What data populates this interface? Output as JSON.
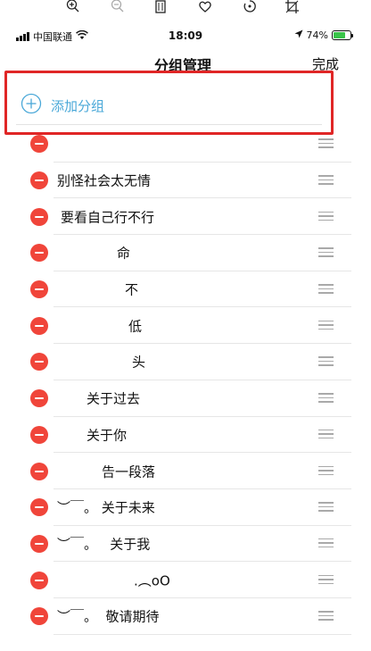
{
  "viewer_toolbar": {
    "icons": [
      "zoom-in-icon",
      "zoom-out-icon",
      "trash-icon",
      "heart-icon",
      "rotate-icon",
      "crop-icon"
    ]
  },
  "status_bar": {
    "carrier": "中国联通",
    "time": "18:09",
    "battery": "74%",
    "battery_level": 0.74,
    "icons": [
      "signal-icon",
      "wifi-icon",
      "location-icon",
      "battery-icon"
    ]
  },
  "nav": {
    "title": "分组管理",
    "done_label": "完成"
  },
  "add_group": {
    "label": "添加分组",
    "icon": "plus-circle-icon"
  },
  "groups": [
    {
      "label": ""
    },
    {
      "label": "别怪社会太无情"
    },
    {
      "label": "要看自己行不行"
    },
    {
      "label": "命"
    },
    {
      "label": "不"
    },
    {
      "label": "低"
    },
    {
      "label": "头"
    },
    {
      "label": "关于过去"
    },
    {
      "label": "关于你"
    },
    {
      "label": "告一段落"
    },
    {
      "label": "︶￣。 关于未来"
    },
    {
      "label": "︶￣。   关于我"
    },
    {
      "label": ".︵oO"
    },
    {
      "label": "︶￣。  敬请期待"
    }
  ],
  "colors": {
    "delete": "#f0453a",
    "accent": "#4aa8d8",
    "highlight_border": "#e02626",
    "battery_fill": "#3ac44a"
  }
}
